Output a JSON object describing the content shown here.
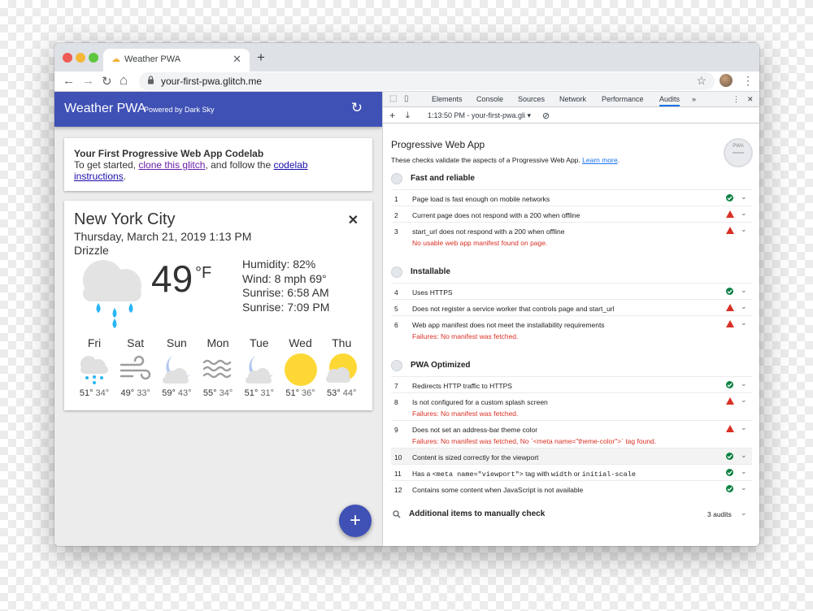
{
  "browser": {
    "tab_title": "Weather PWA",
    "tab_close": "✕",
    "new_tab": "+",
    "url": "your-first-pwa.glitch.me",
    "back": "←",
    "forward": "→",
    "reload": "↻",
    "home": "⌂",
    "lock": "🔒",
    "star": "☆",
    "menu": "⋮",
    "traffic_colors": [
      "#ee5c56",
      "#f5b738",
      "#5fc63f"
    ]
  },
  "app": {
    "title": "Weather PWA",
    "powered": "Powered by Dark Sky",
    "refresh": "↻",
    "codelab": {
      "heading": "Your First Progressive Web App Codelab",
      "text1": "To get started, ",
      "link1": "clone this glitch",
      "text2": ", and follow the ",
      "link2": "codelab instructions",
      "text3": "."
    },
    "weather": {
      "city": "New York City",
      "date": "Thursday, March 21, 2019 1:13 PM",
      "desc": "Drizzle",
      "temp": "49",
      "unit": "°F",
      "close": "✕",
      "humidity": "Humidity: 82%",
      "wind": "Wind: 8 mph 69°",
      "sunrise": "Sunrise: 6:58 AM",
      "sunset": "Sunrise: 7:09 PM",
      "forecast": [
        {
          "day": "Fri",
          "hi": "51°",
          "lo": "34°",
          "icon": "rain-cloud-icon"
        },
        {
          "day": "Sat",
          "hi": "49°",
          "lo": "33°",
          "icon": "wind-icon"
        },
        {
          "day": "Sun",
          "hi": "59°",
          "lo": "43°",
          "icon": "partly-cloudy-night-icon"
        },
        {
          "day": "Mon",
          "hi": "55°",
          "lo": "34°",
          "icon": "fog-icon"
        },
        {
          "day": "Tue",
          "hi": "51°",
          "lo": "31°",
          "icon": "partly-cloudy-night-icon"
        },
        {
          "day": "Wed",
          "hi": "51°",
          "lo": "36°",
          "icon": "sun-icon"
        },
        {
          "day": "Thu",
          "hi": "53°",
          "lo": "44°",
          "icon": "partly-cloudy-day-icon"
        }
      ]
    },
    "fab": "+"
  },
  "devtools": {
    "tabs": [
      "Elements",
      "Console",
      "Sources",
      "Network",
      "Performance",
      "Audits"
    ],
    "active_tab": "Audits",
    "more": "»",
    "menu": "⋮",
    "close": "✕",
    "inspect": "⬚",
    "device": "▯",
    "sub_add": "+",
    "sub_download": "⤓",
    "sub_report": "1:13:50 PM - your-first-pwa.gli ▾",
    "sub_clear": "⊘",
    "report": {
      "title": "Progressive Web App",
      "desc": "These checks validate the aspects of a Progressive Web App. ",
      "learn": "Learn more",
      "desc_end": ".",
      "gauge": "PWA",
      "groups": [
        {
          "name": "Fast and reliable",
          "audits": [
            {
              "n": "1",
              "text": "Page load is fast enough on mobile networks",
              "status": "pass"
            },
            {
              "n": "2",
              "text": "Current page does not respond with a 200 when offline",
              "status": "fail"
            },
            {
              "n": "3",
              "text": "start_url does not respond with a 200 when offline",
              "status": "fail",
              "error": "No usable web app manifest found on page."
            }
          ]
        },
        {
          "name": "Installable",
          "audits": [
            {
              "n": "4",
              "text": "Uses HTTPS",
              "status": "pass"
            },
            {
              "n": "5",
              "text": "Does not register a service worker that controls page and start_url",
              "status": "fail"
            },
            {
              "n": "6",
              "text": "Web app manifest does not meet the installability requirements",
              "status": "fail",
              "error": "Failures: No manifest was fetched."
            }
          ]
        },
        {
          "name": "PWA Optimized",
          "audits": [
            {
              "n": "7",
              "text": "Redirects HTTP traffic to HTTPS",
              "status": "pass"
            },
            {
              "n": "8",
              "text": "Is not configured for a custom splash screen",
              "status": "fail",
              "error": "Failures: No manifest was fetched."
            },
            {
              "n": "9",
              "text": "Does not set an address-bar theme color",
              "status": "fail",
              "error": "Failures: No manifest was fetched, No `<meta name=\"theme-color\">` tag found."
            },
            {
              "n": "10",
              "text": "Content is sized correctly for the viewport",
              "status": "pass"
            },
            {
              "n": "11",
              "text_a": "Has a ",
              "code1": "<meta name=\"viewport\">",
              "text_b": " tag with ",
              "code2": "width",
              "text_c": " or ",
              "code3": "initial-scale",
              "status": "pass"
            },
            {
              "n": "12",
              "text": "Contains some content when JavaScript is not available",
              "status": "pass"
            }
          ]
        }
      ],
      "manual": {
        "label": "Additional items to manually check",
        "count": "3 audits"
      }
    }
  }
}
